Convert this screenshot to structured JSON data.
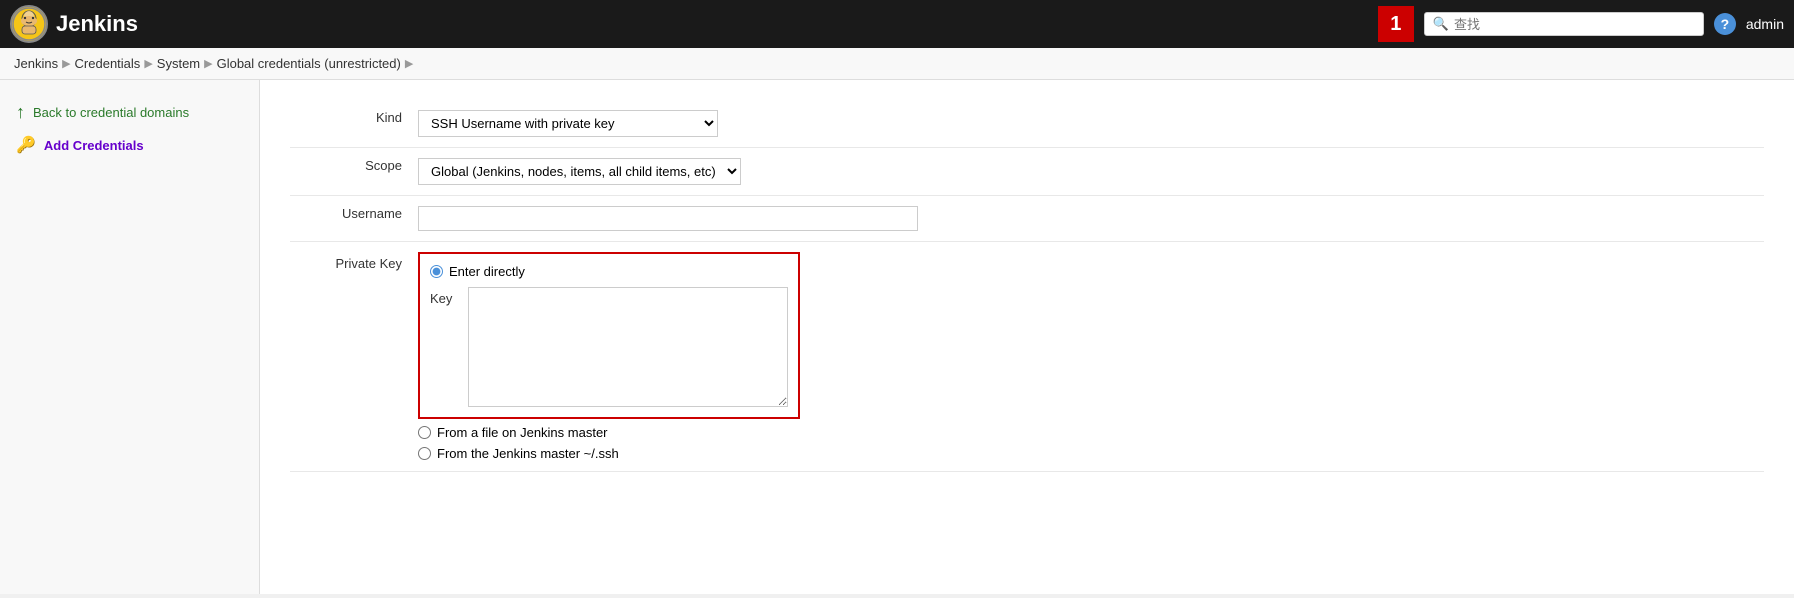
{
  "header": {
    "logo_text": "Jenkins",
    "build_count": "1",
    "search_placeholder": "查找",
    "help_label": "?",
    "admin_label": "admin"
  },
  "breadcrumb": {
    "items": [
      {
        "label": "Jenkins",
        "href": "#"
      },
      {
        "label": "Credentials",
        "href": "#"
      },
      {
        "label": "System",
        "href": "#"
      },
      {
        "label": "Global credentials (unrestricted)",
        "href": "#"
      }
    ]
  },
  "sidebar": {
    "back_label": "Back to credential domains",
    "add_label": "Add Credentials"
  },
  "form": {
    "kind_label": "Kind",
    "kind_value": "SSH Username with private key",
    "scope_label": "Scope",
    "scope_value": "Global (Jenkins, nodes, items, all child items, etc)",
    "username_label": "Username",
    "username_value": "",
    "private_key_label": "Private Key",
    "enter_directly_label": "Enter directly",
    "key_label": "Key",
    "key_value": "",
    "from_file_label": "From a file on Jenkins master",
    "from_ssh_label": "From the Jenkins master ~/.ssh"
  }
}
